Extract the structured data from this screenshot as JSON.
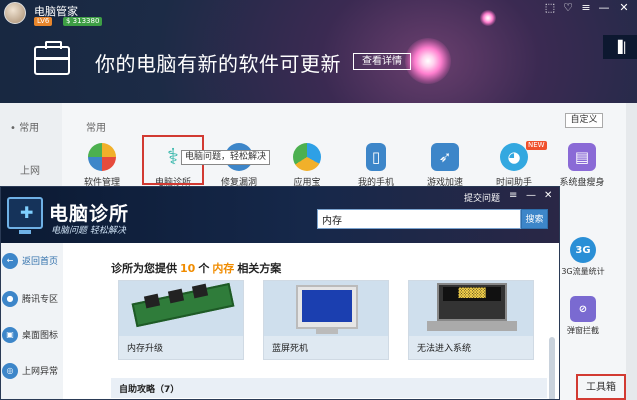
{
  "pc_manager": {
    "title": "电脑管家",
    "level": "LV6",
    "coins": "$ 313380",
    "banner_text": "你的电脑有新的软件可更新",
    "details_button": "查看详情",
    "left_common": "常用",
    "left_web": "上网",
    "section_label": "常用",
    "customize_button": "自定义",
    "tooltip": "电脑问题，轻松解决",
    "apps": [
      {
        "label": "软件管理",
        "icon": "software-manager-icon",
        "color": "#f1b02a"
      },
      {
        "label": "电脑诊所",
        "icon": "stethoscope-icon",
        "color": "#2bb3a6"
      },
      {
        "label": "修复漏洞",
        "icon": "patch-icon",
        "color": "#3d86c9"
      },
      {
        "label": "应用宝",
        "icon": "app-store-icon",
        "color": "#2ea0e6"
      },
      {
        "label": "我的手机",
        "icon": "phone-icon",
        "color": "#3d86c9"
      },
      {
        "label": "游戏加速",
        "icon": "game-boost-icon",
        "color": "#3d86c9"
      },
      {
        "label": "时间助手",
        "icon": "time-assistant-icon",
        "color": "#33a8e0"
      },
      {
        "label": "系统盘瘦身",
        "icon": "disk-slim-icon",
        "color": "#8a6ad6"
      }
    ],
    "new_badge": "NEW",
    "side_tools": [
      {
        "label": "3G流量统计",
        "icon_text": "3G",
        "color": "#2a8fd6"
      },
      {
        "label": "弹窗拦截",
        "icon_text": "⊘",
        "color": "#7a6ad1"
      }
    ],
    "toolbox_label": "工具箱",
    "window_controls": [
      "⬚",
      "♡",
      "≡",
      "—",
      "✕"
    ]
  },
  "clinic": {
    "title": "电脑诊所",
    "slogan": "电脑问题 轻松解决",
    "feedback": "提交问题",
    "controls": [
      "≡",
      "—",
      "✕"
    ],
    "search_value": "内存",
    "search_button": "搜索",
    "nav": [
      {
        "label": "返回首页",
        "icon": "←"
      },
      {
        "label": "腾讯专区",
        "icon": "●"
      },
      {
        "label": "桌面图标",
        "icon": "▣"
      },
      {
        "label": "上网异常",
        "icon": "◎"
      }
    ],
    "result_prefix": "诊所为您提供",
    "result_count": "10",
    "result_mid": "个",
    "result_keyword": "内存",
    "result_suffix": "相关方案",
    "cards": [
      {
        "caption": "内存升级"
      },
      {
        "caption": "蓝屏死机"
      },
      {
        "caption": "无法进入系统"
      }
    ],
    "guide_label": "自助攻略（7）"
  }
}
